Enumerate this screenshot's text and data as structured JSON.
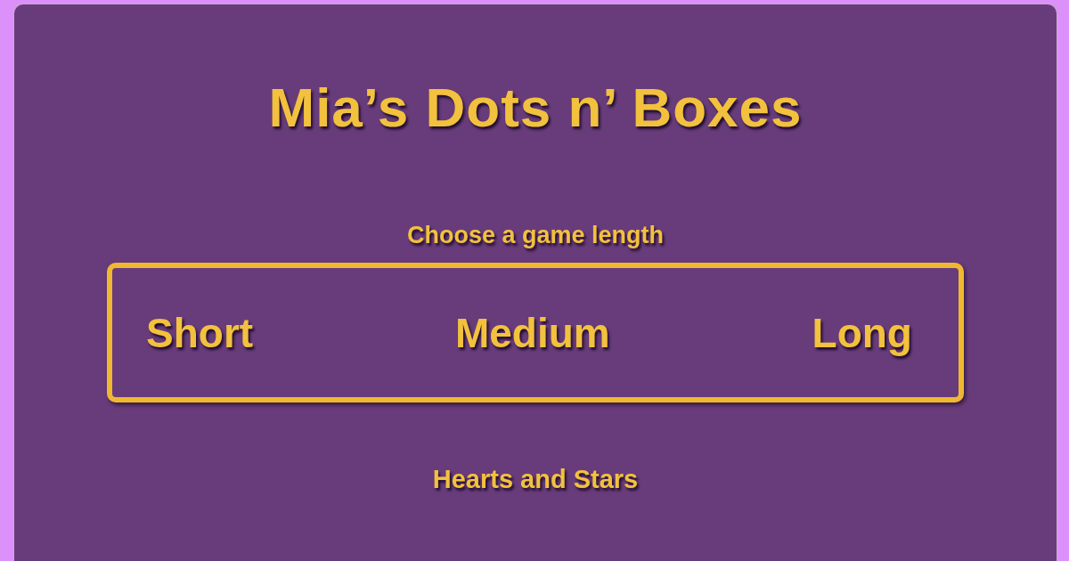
{
  "title": "Mia’s Dots n’ Boxes",
  "prompt": "Choose a game length",
  "game_lengths": [
    {
      "label": "Short"
    },
    {
      "label": "Medium"
    },
    {
      "label": "Long"
    }
  ],
  "theme": "Hearts and Stars"
}
